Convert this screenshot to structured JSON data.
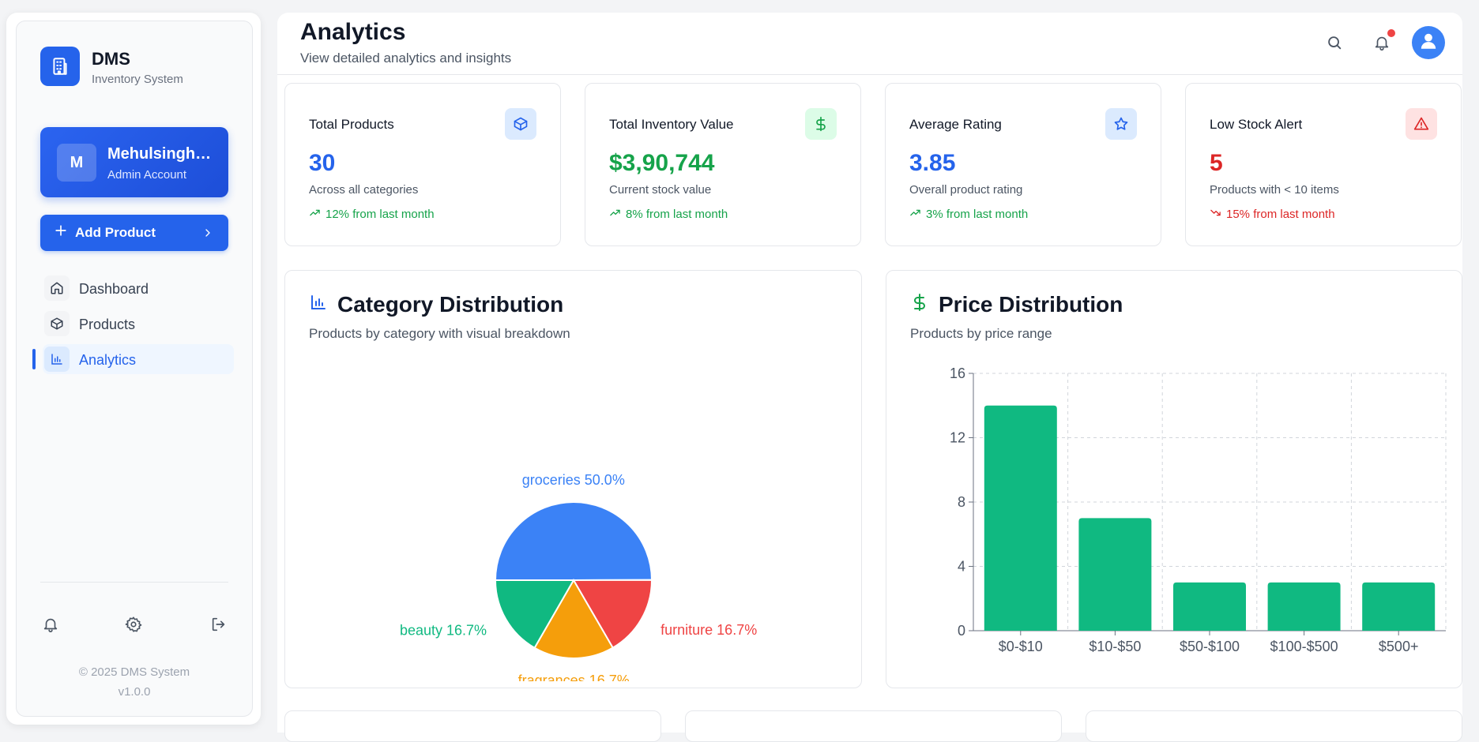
{
  "sidebar": {
    "brand_title": "DMS",
    "brand_subtitle": "Inventory System",
    "user": {
      "initial": "M",
      "name": "Mehulsinghsdfsdfs",
      "role": "Admin Account"
    },
    "add_button_label": "Add Product",
    "nav": [
      {
        "label": "Dashboard",
        "icon": "home-icon",
        "active": false
      },
      {
        "label": "Products",
        "icon": "package-icon",
        "active": false
      },
      {
        "label": "Analytics",
        "icon": "bar-chart-icon",
        "active": true
      }
    ],
    "footer_icons": [
      "bell-icon",
      "gear-icon",
      "logout-icon"
    ],
    "copyright": "© 2025 DMS System",
    "version": "v1.0.0"
  },
  "header": {
    "title": "Analytics",
    "subtitle": "View detailed analytics and insights"
  },
  "stats": [
    {
      "title": "Total Products",
      "value": "30",
      "desc": "Across all categories",
      "trend": "12% from last month",
      "trend_dir": "up",
      "icon": "box-icon",
      "value_color": "#2563eb",
      "badge_bg": "#dbeafe",
      "icon_color": "#2563eb"
    },
    {
      "title": "Total Inventory Value",
      "value": "$3,90,744",
      "desc": "Current stock value",
      "trend": "8% from last month",
      "trend_dir": "up",
      "icon": "dollar-icon",
      "value_color": "#16a34a",
      "badge_bg": "#dcfce7",
      "icon_color": "#16a34a"
    },
    {
      "title": "Average Rating",
      "value": "3.85",
      "desc": "Overall product rating",
      "trend": "3% from last month",
      "trend_dir": "up",
      "icon": "star-icon",
      "value_color": "#2563eb",
      "badge_bg": "#dbeafe",
      "icon_color": "#2563eb"
    },
    {
      "title": "Low Stock Alert",
      "value": "5",
      "desc": "Products with < 10 items",
      "trend": "15% from last month",
      "trend_dir": "down",
      "icon": "alert-triangle-icon",
      "value_color": "#dc2626",
      "badge_bg": "#fee2e2",
      "icon_color": "#dc2626"
    }
  ],
  "category_panel": {
    "title": "Category Distribution",
    "subtitle": "Products by category with visual breakdown"
  },
  "price_panel": {
    "title": "Price Distribution",
    "subtitle": "Products by price range"
  },
  "chart_data": [
    {
      "type": "pie",
      "title": "Category Distribution",
      "slices": [
        {
          "label": "groceries",
          "value": 50.0,
          "color": "#3b82f6"
        },
        {
          "label": "furniture",
          "value": 16.7,
          "color": "#ef4444"
        },
        {
          "label": "fragrances",
          "value": 16.7,
          "color": "#f59e0b"
        },
        {
          "label": "beauty",
          "value": 16.7,
          "color": "#10b981"
        }
      ]
    },
    {
      "type": "bar",
      "title": "Price Distribution",
      "categories": [
        "$0-$10",
        "$10-$50",
        "$50-$100",
        "$100-$500",
        "$500+"
      ],
      "values": [
        14,
        7,
        3,
        3,
        3
      ],
      "ylim": [
        0,
        16
      ],
      "yticks": [
        0,
        4,
        8,
        12,
        16
      ],
      "grid": true,
      "color": "#10b981"
    }
  ]
}
